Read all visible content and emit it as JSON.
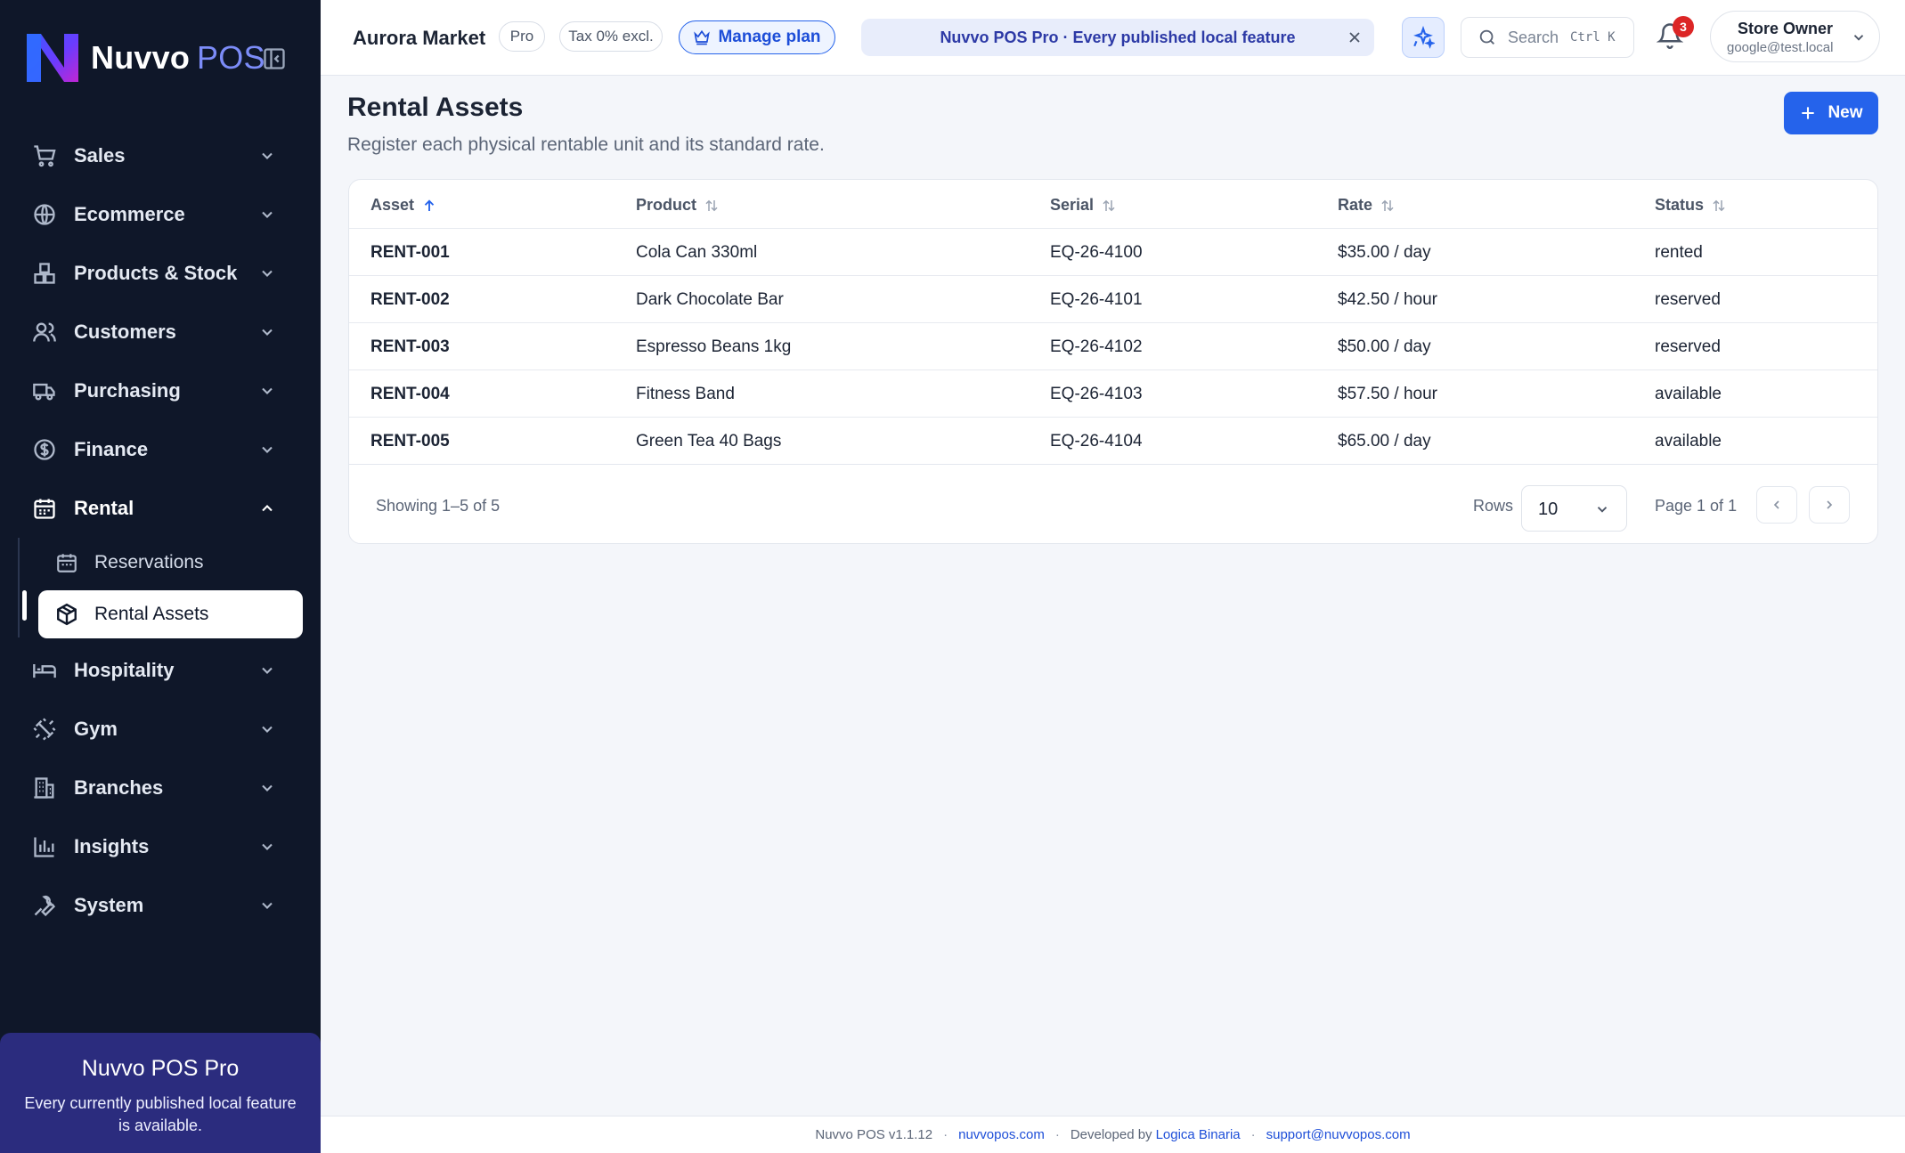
{
  "brand": {
    "name_a": "Nuvvo",
    "name_b": "POS"
  },
  "sidebar": {
    "items": [
      {
        "label": "Sales",
        "icon": "cart-icon"
      },
      {
        "label": "Ecommerce",
        "icon": "globe-icon"
      },
      {
        "label": "Products & Stock",
        "icon": "boxes-icon"
      },
      {
        "label": "Customers",
        "icon": "users-icon"
      },
      {
        "label": "Purchasing",
        "icon": "truck-icon"
      },
      {
        "label": "Finance",
        "icon": "dollar-circle-icon"
      },
      {
        "label": "Rental",
        "icon": "calendar-icon"
      },
      {
        "label": "Hospitality",
        "icon": "bed-icon"
      },
      {
        "label": "Gym",
        "icon": "dumbbell-icon"
      },
      {
        "label": "Branches",
        "icon": "building-icon"
      },
      {
        "label": "Insights",
        "icon": "bar-chart-icon"
      },
      {
        "label": "System",
        "icon": "wrench-icon"
      }
    ],
    "rental_sub": [
      {
        "label": "Reservations",
        "icon": "calendar-icon"
      },
      {
        "label": "Rental Assets",
        "icon": "package-icon"
      }
    ],
    "promo": {
      "title": "Nuvvo POS Pro",
      "text": "Every currently published local feature is available."
    }
  },
  "topbar": {
    "store": "Aurora Market",
    "plan_chip": "Pro",
    "tax_chip": "Tax 0% excl.",
    "manage_plan": "Manage plan",
    "announcement": "Nuvvo POS Pro · Every published local feature",
    "search_placeholder": "Search",
    "search_shortcut": "Ctrl K",
    "notifications": "3",
    "user_name": "Store Owner",
    "user_email": "google@test.local"
  },
  "page": {
    "title": "Rental Assets",
    "subtitle": "Register each physical rentable unit and its standard rate.",
    "new_label": "New"
  },
  "table": {
    "columns": [
      "Asset",
      "Product",
      "Serial",
      "Rate",
      "Status"
    ],
    "rows": [
      {
        "asset": "RENT-001",
        "product": "Cola Can 330ml",
        "serial": "EQ-26-4100",
        "rate": "$35.00 / day",
        "status": "rented"
      },
      {
        "asset": "RENT-002",
        "product": "Dark Chocolate Bar",
        "serial": "EQ-26-4101",
        "rate": "$42.50 / hour",
        "status": "reserved"
      },
      {
        "asset": "RENT-003",
        "product": "Espresso Beans 1kg",
        "serial": "EQ-26-4102",
        "rate": "$50.00 / day",
        "status": "reserved"
      },
      {
        "asset": "RENT-004",
        "product": "Fitness Band",
        "serial": "EQ-26-4103",
        "rate": "$57.50 / hour",
        "status": "available"
      },
      {
        "asset": "RENT-005",
        "product": "Green Tea 40 Bags",
        "serial": "EQ-26-4104",
        "rate": "$65.00 / day",
        "status": "available"
      }
    ],
    "showing": "Showing 1–5 of 5",
    "rows_label": "Rows",
    "rows_value": "10",
    "page_info": "Page 1 of 1"
  },
  "footer": {
    "version": "Nuvvo POS v1.1.12",
    "site": "nuvvopos.com",
    "dev_prefix": "Developed by",
    "dev": "Logica Binaria",
    "email": "support@nuvvopos.com"
  },
  "colors": {
    "sidebar_bg": "#0f1729",
    "accent": "#2563eb",
    "promo_bg": "#2b2c7e",
    "badge": "#dc2626"
  }
}
